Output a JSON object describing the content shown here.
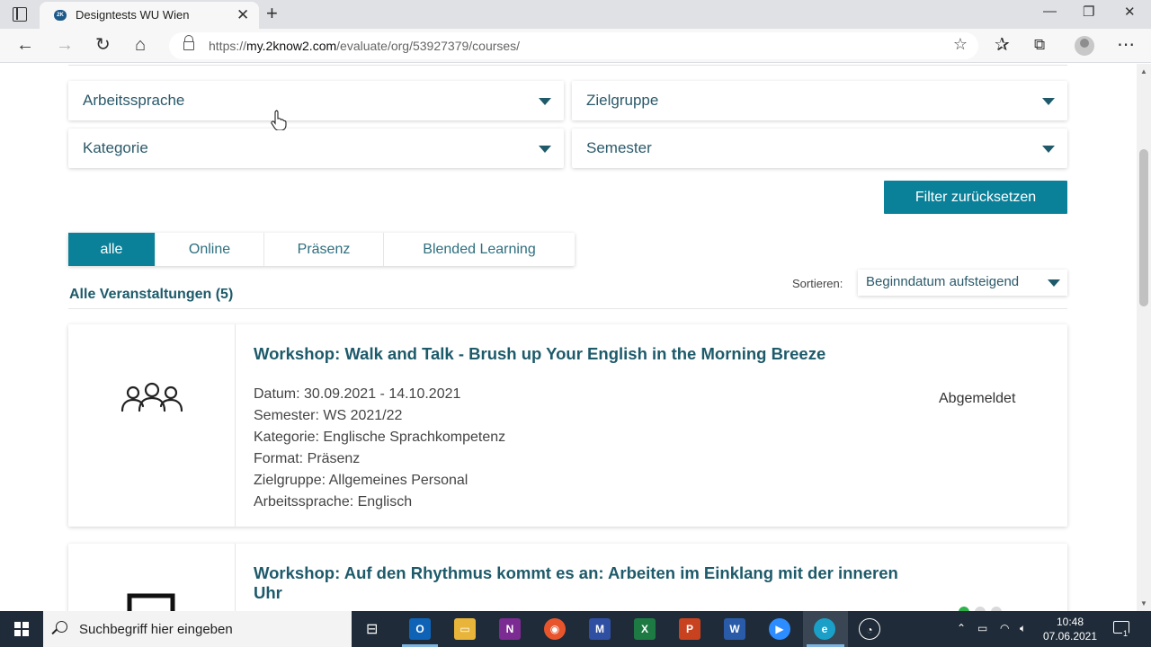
{
  "browser": {
    "tab_title": "Designtests WU Wien",
    "url_prefix": "https://",
    "url_host": "my.2know2.com",
    "url_path": "/evaluate/org/53927379/courses/"
  },
  "filters": {
    "arbeitssprache": "Arbeitssprache",
    "zielgruppe": "Zielgruppe",
    "kategorie": "Kategorie",
    "semester": "Semester",
    "reset_label": "Filter zurücksetzen"
  },
  "format_tabs": [
    {
      "label": "alle",
      "active": true
    },
    {
      "label": "Online",
      "active": false
    },
    {
      "label": "Präsenz",
      "active": false
    },
    {
      "label": "Blended Learning",
      "active": false
    }
  ],
  "list": {
    "heading": "Alle Veranstaltungen (5)",
    "sort_label": "Sortieren:",
    "sort_value": "Beginndatum aufsteigend"
  },
  "courses": [
    {
      "title": "Workshop: Walk and Talk - Brush up Your English in the Morning Breeze",
      "datum": "Datum: 30.09.2021 - 14.10.2021",
      "semester": "Semester: WS 2021/22",
      "kategorie": "Kategorie: Englische Sprachkompetenz",
      "format": "Format: Präsenz",
      "zielgruppe": "Zielgruppe: Allgemeines Personal",
      "arbeitssprache": "Arbeitssprache: Englisch",
      "status": "Abgemeldet",
      "icon": "group-people-icon"
    },
    {
      "title": "Workshop: Auf den Rhythmus kommt es an: Arbeiten im Einklang mit der inneren Uhr",
      "icon": "frame-icon"
    }
  ],
  "taskbar": {
    "search_placeholder": "Suchbegriff hier eingeben",
    "time": "10:48",
    "date": "07.06.2021",
    "notification_count": "1"
  },
  "colors": {
    "accent": "#0b8199",
    "heading": "#1d5a6a",
    "status_active": "#2db34a"
  }
}
